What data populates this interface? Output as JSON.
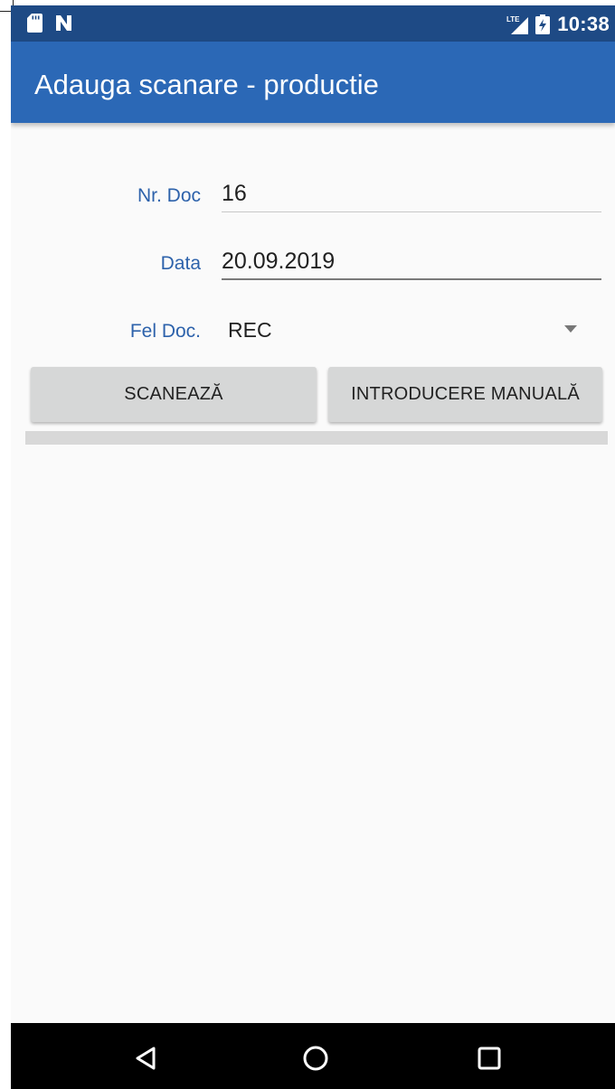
{
  "status_bar": {
    "time": "10:38",
    "network": "LTE",
    "icons": [
      "sd-card-icon",
      "n-notification-icon",
      "lte-signal-icon",
      "battery-icon"
    ]
  },
  "app_bar": {
    "title": "Adauga scanare - productie"
  },
  "form": {
    "nr_doc": {
      "label": "Nr. Doc",
      "value": "16"
    },
    "data": {
      "label": "Data",
      "value": "20.09.2019"
    },
    "fel_doc": {
      "label": "Fel Doc.",
      "selected": "REC"
    }
  },
  "buttons": {
    "scan_label": "SCANEAZĂ",
    "manual_label": "INTRODUCERE MANUALĂ"
  },
  "navigation": {
    "icons": [
      "back-icon",
      "home-icon",
      "recents-icon"
    ]
  },
  "colors": {
    "status_bar": "#1e4a85",
    "app_bar": "#2b68b6",
    "label_text": "#2d62ab",
    "button_bg": "#d6d7d7",
    "nav_bar": "#000000"
  }
}
